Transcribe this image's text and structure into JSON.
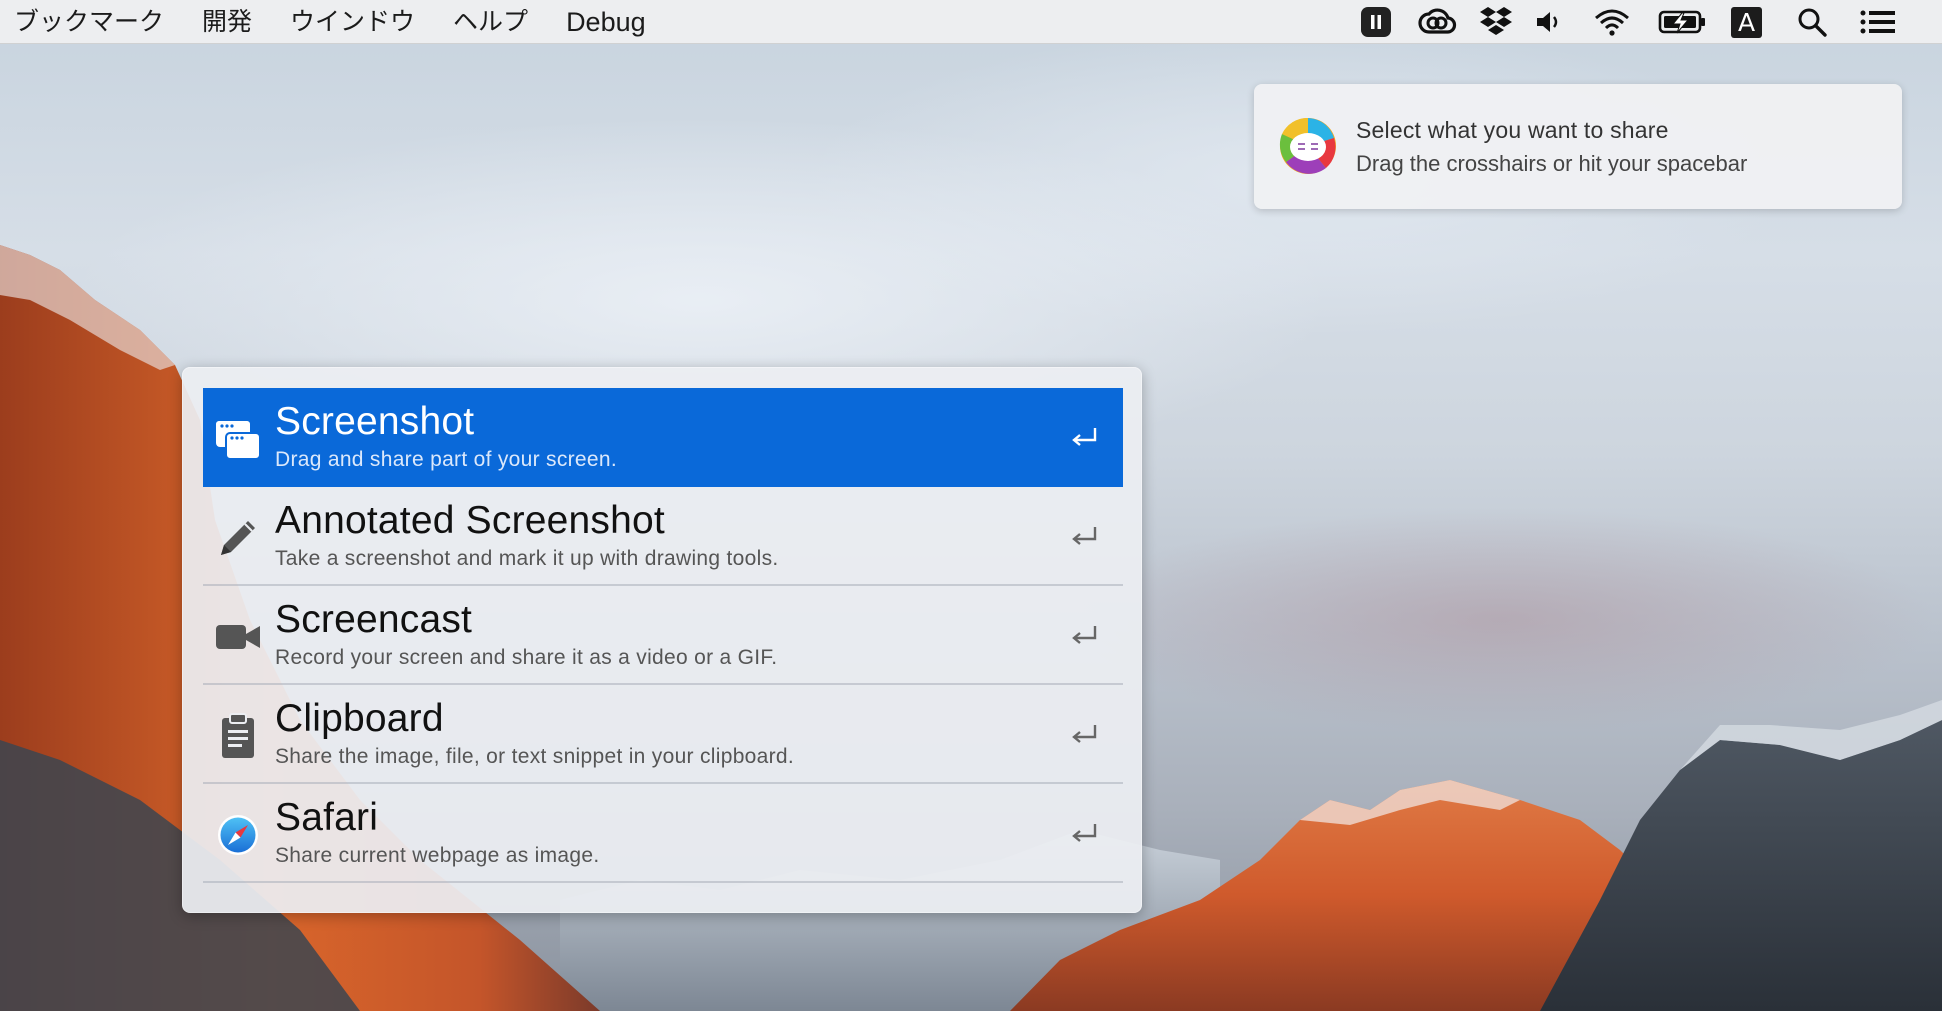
{
  "menubar": {
    "items": [
      {
        "label": "ブックマーク"
      },
      {
        "label": "開発"
      },
      {
        "label": "ウインドウ"
      },
      {
        "label": "ヘルプ"
      },
      {
        "label": "Debug"
      }
    ],
    "tray": {
      "input_source_label": "A",
      "icons": [
        "pause-app-icon",
        "creative-cloud-icon",
        "dropbox-icon",
        "volume-icon",
        "wifi-icon",
        "battery-charging-icon",
        "input-source-icon",
        "spotlight-search-icon",
        "notification-center-icon"
      ]
    }
  },
  "notification": {
    "title": "Select what you want to share",
    "body": "Drag the crosshairs or hit your spacebar",
    "icon": "cloudapp-logo-icon"
  },
  "share_panel": {
    "selected_index": 0,
    "items": [
      {
        "title": "Screenshot",
        "subtitle": "Drag and share part of your screen.",
        "icon": "screenshot-icon"
      },
      {
        "title": "Annotated Screenshot",
        "subtitle": "Take a screenshot and mark it up with drawing tools.",
        "icon": "pencil-icon"
      },
      {
        "title": "Screencast",
        "subtitle": "Record your screen and share it as a video or a GIF.",
        "icon": "video-camera-icon"
      },
      {
        "title": "Clipboard",
        "subtitle": "Share the image, file, or text snippet in your clipboard.",
        "icon": "clipboard-icon"
      },
      {
        "title": "Safari",
        "subtitle": "Share current webpage as image.",
        "icon": "safari-compass-icon"
      }
    ],
    "enter_key_icon": "return-key-icon"
  },
  "colors": {
    "selection": "#0a69d9",
    "menubar": "#eeeef0"
  }
}
